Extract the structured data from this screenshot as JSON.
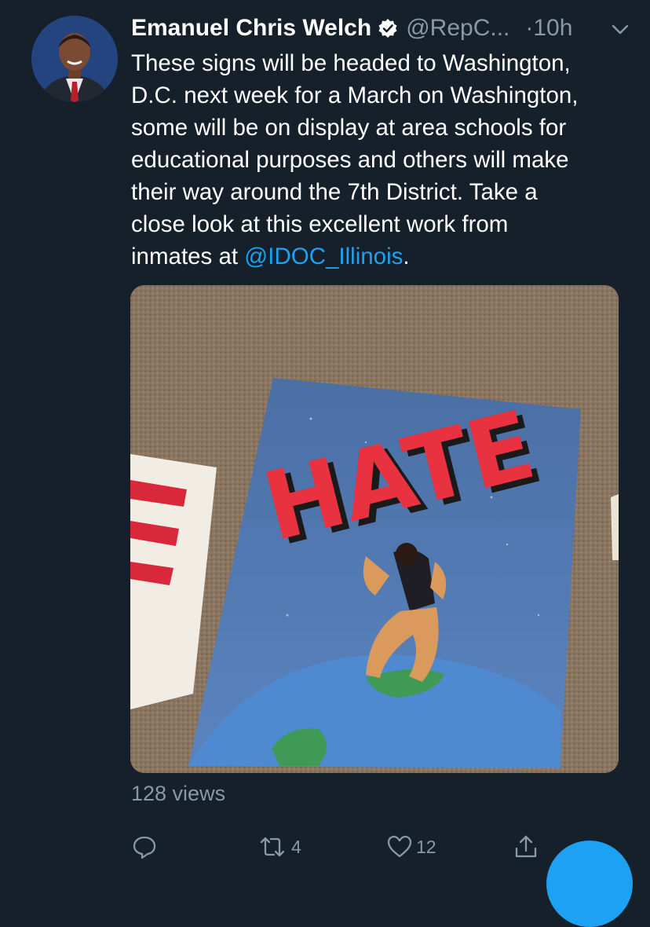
{
  "tweet": {
    "author": {
      "name": "Emanuel Chris Welch",
      "handle": "@RepC...",
      "verified": true
    },
    "time": "·10h",
    "body_lines": [
      "These signs will be headed to Washington,",
      "D.C. next week for a March on Washington,",
      "some will be on display at area schools for",
      "educational purposes and others will make",
      "their way around the 7th District.  Take a",
      "close look at this excellent work from"
    ],
    "body_last_prefix": "inmates at ",
    "mention": "@IDOC_Illinois",
    "body_last_suffix": ".",
    "media": {
      "artwork_text": "HATE"
    },
    "views": "128 views",
    "actions": {
      "reply_icon": "reply-icon",
      "retweet_icon": "retweet-icon",
      "retweet_count": "4",
      "like_icon": "heart-icon",
      "like_count": "12",
      "share_icon": "share-icon"
    }
  },
  "colors": {
    "background": "#15202b",
    "text": "#ffffff",
    "secondary": "#8899a6",
    "accent": "#1da1f2"
  }
}
